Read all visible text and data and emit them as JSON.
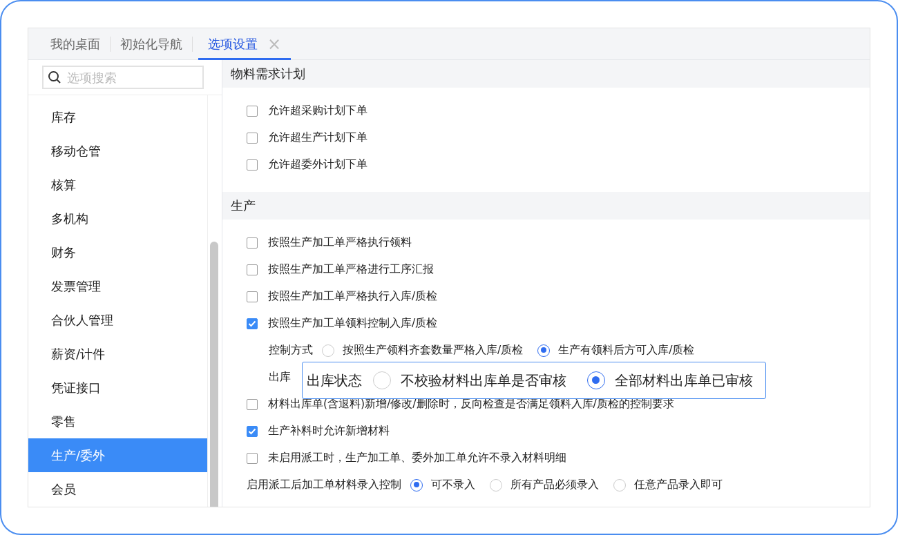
{
  "tabs": [
    {
      "label": "我的桌面",
      "selected": false
    },
    {
      "label": "初始化导航",
      "selected": false
    },
    {
      "label": "选项设置",
      "selected": true,
      "close_glyph": "×"
    }
  ],
  "search": {
    "placeholder": "选项搜索"
  },
  "sidebar": {
    "items": [
      {
        "label": "库存",
        "selected": false
      },
      {
        "label": "移动仓管",
        "selected": false
      },
      {
        "label": "核算",
        "selected": false
      },
      {
        "label": "多机构",
        "selected": false
      },
      {
        "label": "财务",
        "selected": false
      },
      {
        "label": "发票管理",
        "selected": false
      },
      {
        "label": "合伙人管理",
        "selected": false
      },
      {
        "label": "薪资/计件",
        "selected": false
      },
      {
        "label": "凭证接口",
        "selected": false
      },
      {
        "label": "零售",
        "selected": false
      },
      {
        "label": "生产/委外",
        "selected": true
      },
      {
        "label": "会员",
        "selected": false
      }
    ]
  },
  "sections": [
    {
      "title": "物料需求计划",
      "items": [
        {
          "kind": "checkbox",
          "label": "允许超采购计划下单",
          "checked": false
        },
        {
          "kind": "checkbox",
          "label": "允许超生产计划下单",
          "checked": false
        },
        {
          "kind": "checkbox",
          "label": "允许超委外计划下单",
          "checked": false
        }
      ]
    },
    {
      "title": "生产",
      "items": [
        {
          "kind": "checkbox",
          "label": "按照生产加工单严格执行领料",
          "checked": false
        },
        {
          "kind": "checkbox",
          "label": "按照生产加工单严格进行工序汇报",
          "checked": false
        },
        {
          "kind": "checkbox",
          "label": "按照生产加工单严格执行入库/质检",
          "checked": false
        },
        {
          "kind": "checkbox",
          "label": "按照生产加工单领料控制入库/质检",
          "checked": true
        },
        {
          "kind": "sub-radio",
          "label": "控制方式",
          "options": [
            {
              "label": "按照生产领料齐套数量严格入库/质检",
              "selected": false
            },
            {
              "label": "生产有领料后方可入库/质检",
              "selected": true
            }
          ]
        },
        {
          "kind": "sub-radio",
          "label": "出库",
          "callout": {
            "label": "出库状态",
            "options": [
              {
                "label": "不校验材料出库单是否审核",
                "selected": false
              },
              {
                "label": "全部材料出库单已审核",
                "selected": true
              }
            ]
          }
        },
        {
          "kind": "checkbox",
          "label": "材料出库单(含退料)新增/修改/删除时，反向检查是否满足领料入库/质检的控制要求",
          "checked": false
        },
        {
          "kind": "checkbox",
          "label": "生产补料时允许新增材料",
          "checked": true
        },
        {
          "kind": "checkbox",
          "label": "未启用派工时，生产加工单、委外加工单允许不录入材料明细",
          "checked": false
        },
        {
          "kind": "radio",
          "label": "启用派工后加工单材料录入控制",
          "options": [
            {
              "label": "可不录入",
              "selected": true
            },
            {
              "label": "所有产品必须录入",
              "selected": false
            },
            {
              "label": "任意产品录入即可",
              "selected": false
            }
          ]
        }
      ]
    }
  ]
}
